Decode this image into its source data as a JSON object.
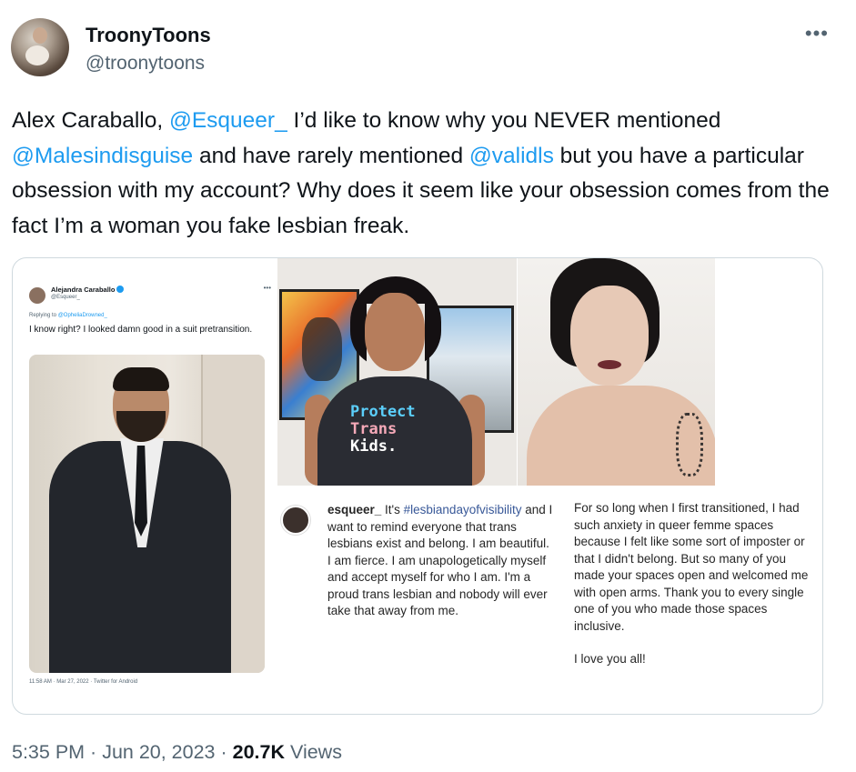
{
  "author": {
    "name": "TroonyToons",
    "handle": "@troonytoons",
    "more_icon": "more-horizontal-icon"
  },
  "tweet": {
    "seg1": "Alex Caraballo, ",
    "mention1": "@Esqueer_",
    "seg2": " I’d like to know why you NEVER mentioned ",
    "mention2": "@Malesindisguise",
    "seg3": " and have rarely mentioned ",
    "mention3": "@validls",
    "seg4": " but you have a particular obsession with my account? Why does it seem like your obsession comes from the fact I’m a woman you fake lesbian freak."
  },
  "media": {
    "embedded_tweet": {
      "name": "Alejandra Caraballo",
      "handle": "@Esqueer_",
      "replying_prefix": "Replying to ",
      "replying_to": "@OpheliaDrowned_",
      "text": "I know right? I looked damn good in a suit pretransition.",
      "meta": "11:58 AM · Mar 27, 2022 · Twitter for Android"
    },
    "shirt_text": [
      "Protect",
      "Trans",
      "Kids."
    ],
    "caption_left": {
      "user": "esqueer_",
      "hashtag": "#lesbiandayofvisibility",
      "pre": " It's ",
      "body": " and I want to remind everyone that trans lesbians exist and belong. I am beautiful. I am fierce. I am unapologetically myself and accept myself for who I am. I'm a proud trans lesbian and nobody will ever take that away from me."
    },
    "caption_right": {
      "para1": "For so long when I first transitioned, I had such anxiety in queer femme spaces because I felt like some sort of imposter or that I didn't belong. But so many of you made your spaces open and welcomed me with open arms. Thank you to every single one of you who made those spaces inclusive.",
      "para2": "I love you all!"
    }
  },
  "footer": {
    "time": "5:35 PM",
    "sep1": " · ",
    "date": "Jun 20, 2023",
    "sep2": " · ",
    "views_count": "20.7K",
    "views_label": " Views"
  },
  "colors": {
    "link": "#1d9bf0",
    "text": "#0f1419",
    "secondary": "#536471",
    "border": "#cfd9de"
  }
}
